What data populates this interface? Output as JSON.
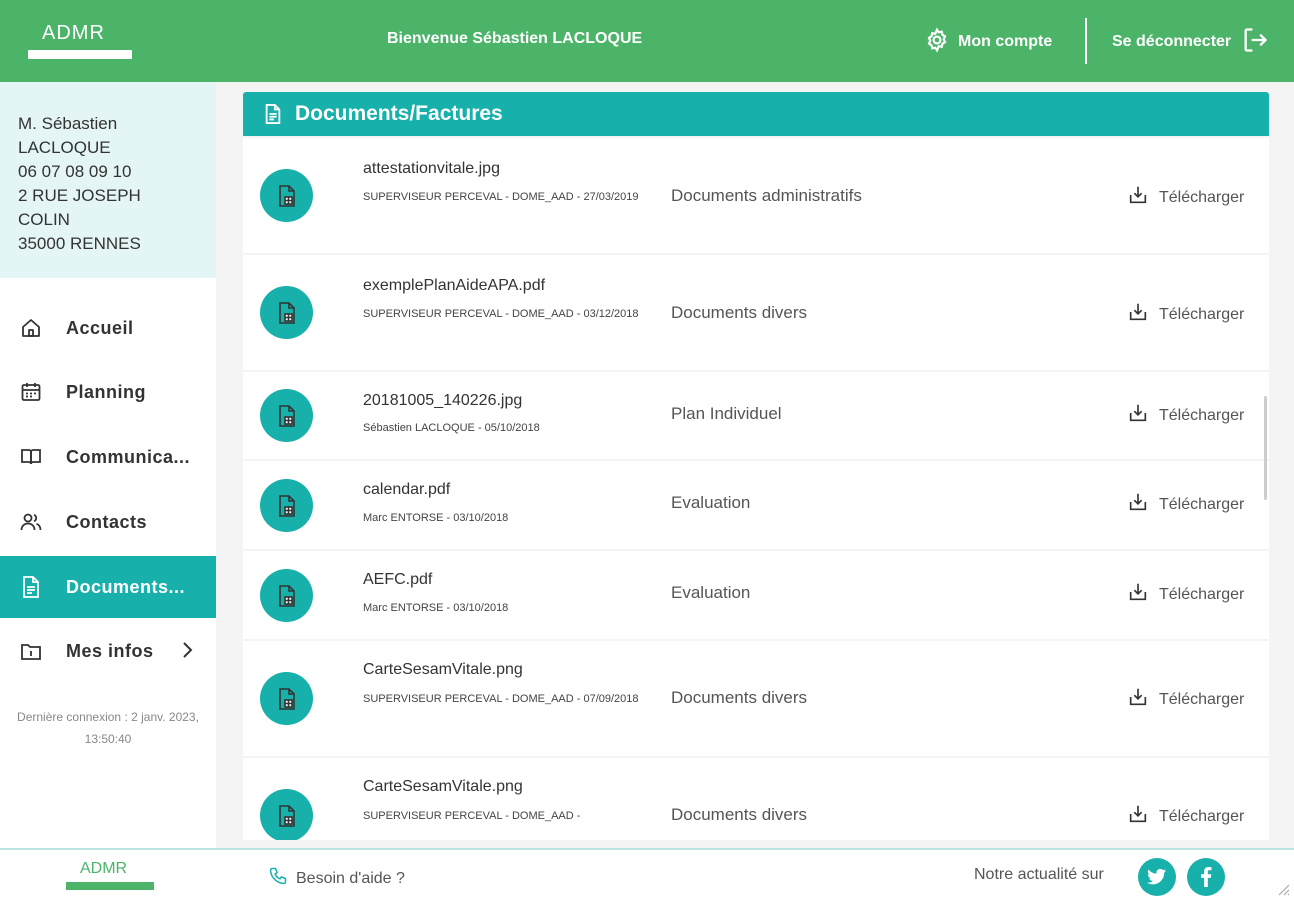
{
  "header": {
    "logo_text": "ADMR",
    "welcome": "Bienvenue Sébastien LACLOQUE",
    "account_label": "Mon compte",
    "logout_label": "Se déconnecter"
  },
  "user": {
    "lines": [
      "M. Sébastien",
      "LACLOQUE",
      "06 07 08 09 10",
      "2 RUE JOSEPH",
      "COLIN",
      "35000 RENNES"
    ]
  },
  "nav": {
    "items": [
      {
        "label": "Accueil",
        "icon": "home-icon"
      },
      {
        "label": "Planning",
        "icon": "calendar-icon"
      },
      {
        "label": "Communica...",
        "icon": "book-icon"
      },
      {
        "label": "Contacts",
        "icon": "users-icon"
      },
      {
        "label": "Documents...",
        "icon": "document-icon",
        "active": true
      },
      {
        "label": "Mes infos",
        "icon": "info-folder-icon"
      }
    ],
    "last_login": [
      "Dernière connexion : 2 janv. 2023,",
      "13:50:40"
    ]
  },
  "main": {
    "title": "Documents/Factures",
    "download_label": "Télécharger",
    "documents": [
      {
        "filename": "attestationvitale.jpg",
        "meta": "SUPERVISEUR PERCEVAL - DOME_AAD - 27/03/2019",
        "category": "Documents administratifs"
      },
      {
        "filename": "exemplePlanAideAPA.pdf",
        "meta": "SUPERVISEUR PERCEVAL - DOME_AAD - 03/12/2018",
        "category": "Documents divers"
      },
      {
        "filename": "20181005_140226.jpg",
        "meta": "Sébastien LACLOQUE - 05/10/2018",
        "category": "Plan Individuel"
      },
      {
        "filename": "calendar.pdf",
        "meta": "Marc ENTORSE - 03/10/2018",
        "category": "Evaluation"
      },
      {
        "filename": "AEFC.pdf",
        "meta": "Marc ENTORSE - 03/10/2018",
        "category": "Evaluation"
      },
      {
        "filename": "CarteSesamVitale.png",
        "meta": "SUPERVISEUR PERCEVAL - DOME_AAD - 07/09/2018",
        "category": "Documents divers"
      },
      {
        "filename": "CarteSesamVitale.png",
        "meta": "SUPERVISEUR PERCEVAL - DOME_AAD -",
        "category": "Documents divers"
      }
    ]
  },
  "footer": {
    "logo_text": "ADMR",
    "help_label": "Besoin d'aide ?",
    "news_label": "Notre actualité sur",
    "social": [
      {
        "icon": "twitter-icon",
        "glyph": "t"
      },
      {
        "icon": "facebook-icon",
        "glyph": "f"
      }
    ]
  },
  "colors": {
    "header_green": "#4cb469",
    "teal": "#18b0ab",
    "userbox_bg": "#e4f5f5"
  }
}
